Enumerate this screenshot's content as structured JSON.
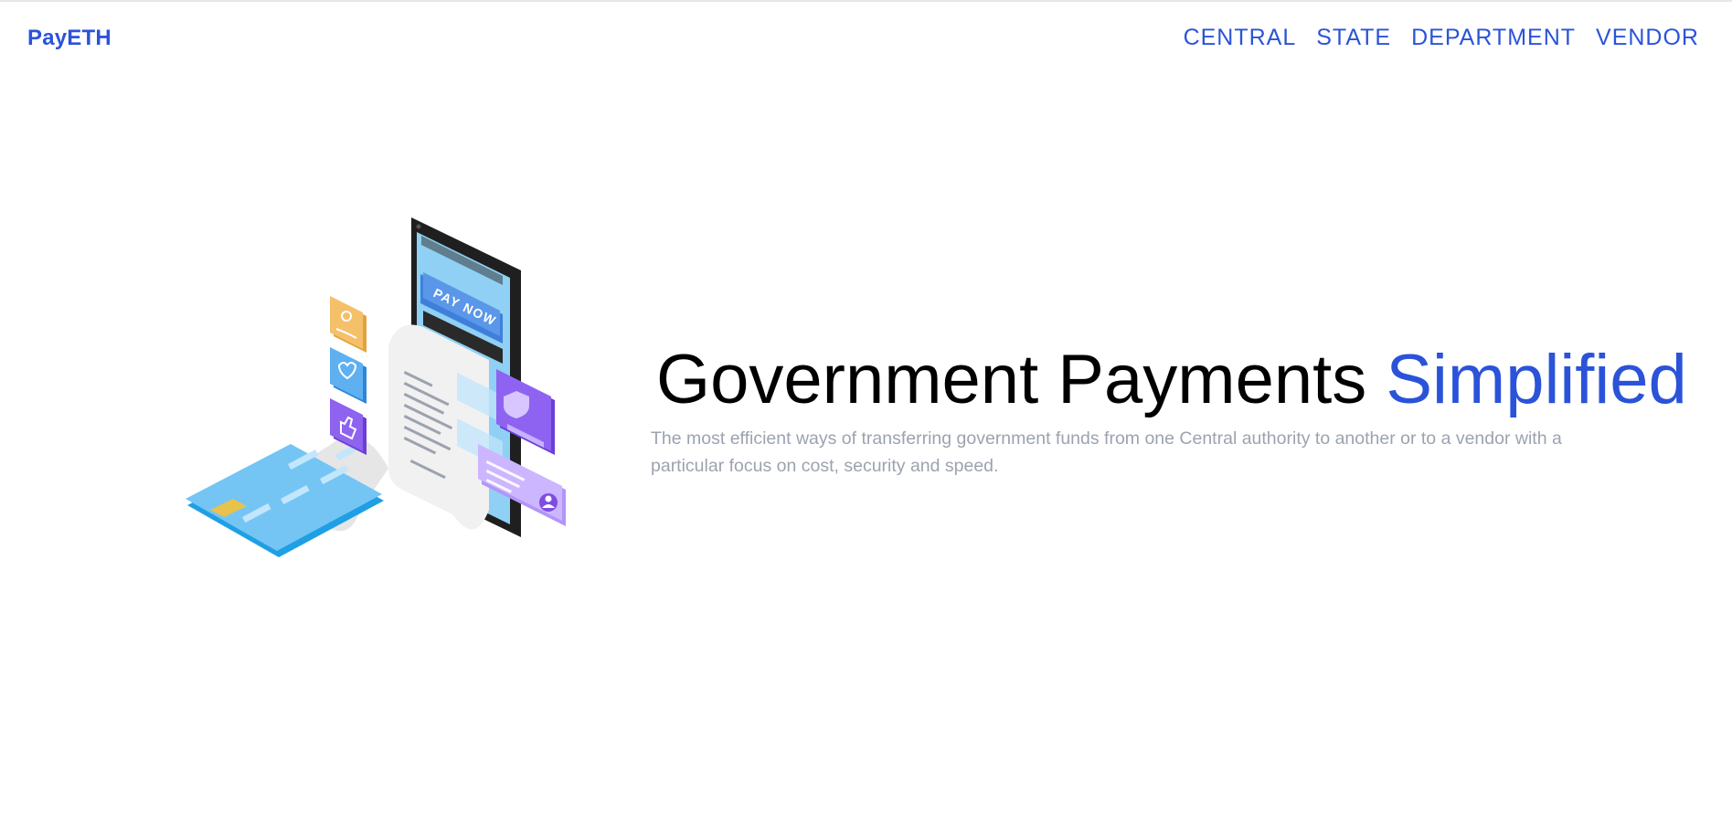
{
  "header": {
    "brand": "PayETH",
    "nav": [
      {
        "label": "CENTRAL"
      },
      {
        "label": "STATE"
      },
      {
        "label": "DEPARTMENT"
      },
      {
        "label": "VENDOR"
      }
    ]
  },
  "hero": {
    "title_main": "Government Payments ",
    "title_accent": "Simplified",
    "description": "The most efficient ways of transferring government funds from one Central authority to another or to a vendor with a particular focus on cost, security and speed.",
    "illustration": {
      "button_text": "PAY NOW",
      "icons": [
        "hand-coin-icon",
        "heart-icon",
        "thumbs-up-icon",
        "shield-icon",
        "user-icon"
      ]
    }
  },
  "colors": {
    "accent": "#2b53d9",
    "muted_text": "#9ca3af"
  }
}
